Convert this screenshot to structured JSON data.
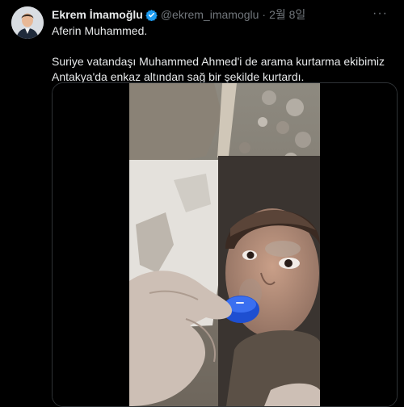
{
  "tweet": {
    "author_name": "Ekrem İmamoğlu",
    "handle": "@ekrem_imamoglu",
    "separator": "·",
    "date": "2월 8일",
    "more_label": "···",
    "text_line1": "Aferin Muhammed.",
    "text_line2": "Suriye vatandaşı Muhammed Ahmed'i de arama kurtarma ekibimiz Antakya'da enkaz altından sağ bir şekilde kurtardı."
  },
  "icons": {
    "verified": "verified-badge-icon",
    "more": "more-options-icon"
  },
  "colors": {
    "background": "#000000",
    "text": "#e7e9ea",
    "secondary_text": "#71767b",
    "verified_blue": "#1d9bf0",
    "border": "#2f3336"
  }
}
